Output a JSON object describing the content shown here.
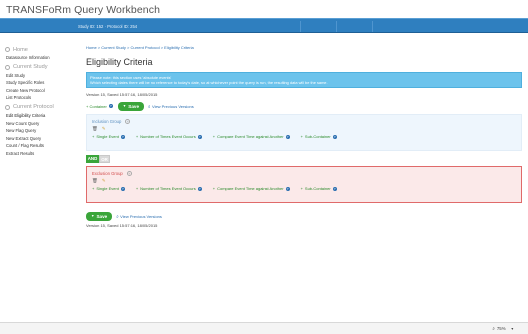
{
  "app": {
    "title": "TRANSFoRm Query Workbench"
  },
  "topbar": {
    "study_info": "Study ID: 152 · Protocol ID: 254"
  },
  "sidebar": {
    "sections": [
      {
        "heading": "Home",
        "icon": "home-icon",
        "items": [
          "Datasource Information"
        ]
      },
      {
        "heading": "Current Study",
        "icon": "study-icon",
        "items": [
          "Edit Study",
          "Study Specific Roles",
          "Create New Protocol",
          "List Protocols"
        ]
      },
      {
        "heading": "Current Protocol",
        "icon": "protocol-icon",
        "items": [
          "Edit Eligibility Criteria",
          "New Count Query",
          "New Flag Query",
          "New Extract Query",
          "Count / Flag Results",
          "Extract Results"
        ]
      }
    ]
  },
  "main": {
    "breadcrumb": "Home > Current Study > Current Protocol > Eligibility Criteria",
    "page_title": "Eligibility Criteria",
    "info_line1": "Please note: this section uses 'absolute events'",
    "info_line2": "Which selecting dates there will be no reference to today's date, so at whichever point the query is run, the resulting data will be the same.",
    "version": "Version 15, Saved 15:57:16, 18/05/2015",
    "container_link": "Container",
    "save_label": "Save",
    "view_previous": "View Previous Versions",
    "inclusion": {
      "title": "Inclusion Group",
      "options": [
        "Single Event",
        "Number of Times Event Occurs",
        "Compare Event Time against Another",
        "Sub-Container"
      ]
    },
    "toggle": {
      "and": "AND",
      "or": "OR"
    },
    "exclusion": {
      "title": "Exclusion Group",
      "options": [
        "Single Event",
        "Number of Times Event Occurs",
        "Compare Event Time against Another",
        "Sub-Container"
      ]
    },
    "bottom_save_label": "Save",
    "bottom_view_previous": "View Previous Versions",
    "bottom_version": "Version 15, Saved 15:57:16, 18/05/2015"
  },
  "statusbar": {
    "zoom": "75%"
  },
  "colors": {
    "topbar": "#2f7fbf",
    "save": "#3aa53a",
    "info": "#6cc3ec",
    "exclusion_border": "#e06a6a"
  }
}
